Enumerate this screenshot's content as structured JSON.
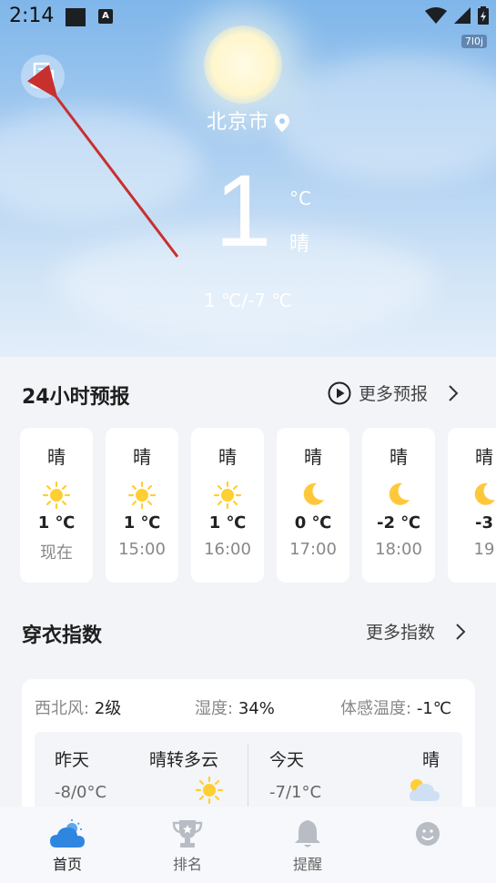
{
  "status_bar": {
    "time": "2:14",
    "badge": "7l0j"
  },
  "location": {
    "city": "北京市"
  },
  "current": {
    "temp": "1",
    "unit": "°C",
    "condition": "晴",
    "range": "1 ℃/-7 ℃"
  },
  "forecast": {
    "title": "24小时预报",
    "more_label": "更多预报",
    "hours": [
      {
        "cond": "晴",
        "icon": "sun-icon",
        "temp": "1 ℃",
        "time": "现在"
      },
      {
        "cond": "晴",
        "icon": "sun-icon",
        "temp": "1 ℃",
        "time": "15:00"
      },
      {
        "cond": "晴",
        "icon": "sun-icon",
        "temp": "1 ℃",
        "time": "16:00"
      },
      {
        "cond": "晴",
        "icon": "moon-icon",
        "temp": "0 ℃",
        "time": "17:00"
      },
      {
        "cond": "晴",
        "icon": "moon-icon",
        "temp": "-2 ℃",
        "time": "18:00"
      },
      {
        "cond": "晴",
        "icon": "moon-icon",
        "temp": "-3",
        "time": "19"
      }
    ]
  },
  "dressing": {
    "title": "穿衣指数",
    "more_label": "更多指数",
    "wind_label": "西北风:",
    "wind_value": "2级",
    "humidity_label": "湿度:",
    "humidity_value": "34%",
    "feels_label": "体感温度:",
    "feels_value": "-1℃",
    "yesterday": {
      "label": "昨天",
      "temp": "-8/0°C",
      "cond": "晴转多云"
    },
    "today": {
      "label": "今天",
      "temp": "-7/1°C",
      "cond": "晴"
    }
  },
  "nav": {
    "home": "首页",
    "rank": "排名",
    "remind": "提醒"
  },
  "colors": {
    "accent": "#3a8ee6",
    "sun": "#ffcf33",
    "moon": "#ffc83a"
  }
}
